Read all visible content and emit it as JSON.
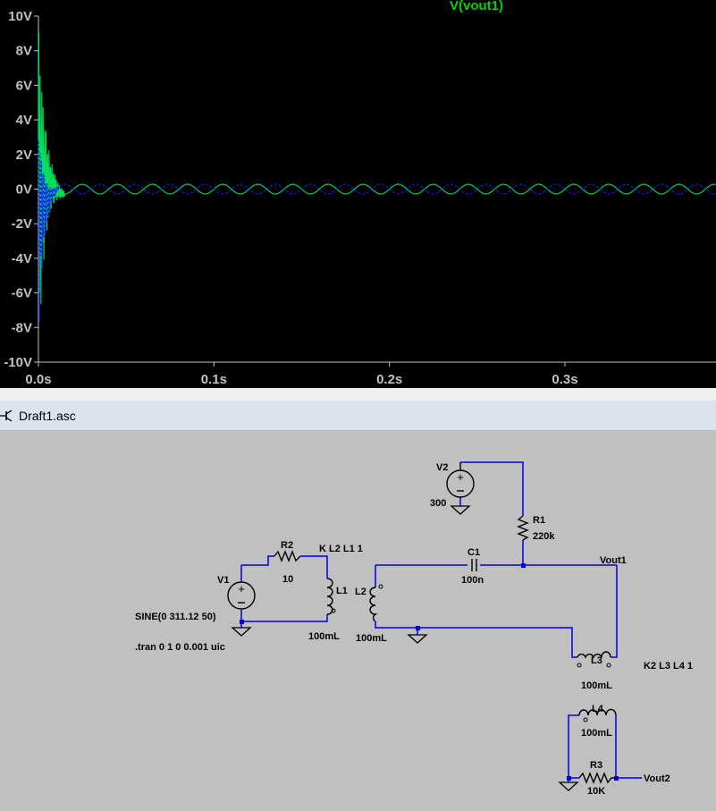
{
  "plot": {
    "trace_name": "V(vout1)",
    "y_ticks": [
      "10V",
      "8V",
      "6V",
      "4V",
      "2V",
      "0V",
      "-2V",
      "-4V",
      "-6V",
      "-8V",
      "-10V"
    ],
    "x_ticks": [
      "0.0s",
      "0.1s",
      "0.2s",
      "0.3s"
    ],
    "colors": {
      "background": "#000000",
      "axis": "#c0c0c0",
      "trace_green": "#00e05a",
      "trace_blue": "#1a1aff"
    }
  },
  "chart_data": {
    "type": "line",
    "title": "V(vout1)",
    "xlabel": "",
    "ylabel": "",
    "xlim": [
      0,
      0.39
    ],
    "ylim": [
      -10,
      10
    ],
    "grid": false,
    "series": [
      {
        "name": "V(vout1)",
        "color": "#00e05a",
        "frequency_hz": 50,
        "steady_amplitude_v": 0.28,
        "initial_spike_v": [
          10,
          -10
        ],
        "settle_time_s": 0.015
      },
      {
        "color": "#1a1aff",
        "frequency_hz": 50,
        "steady_amplitude_v": 0.28,
        "initial_spike_v": [
          3.3,
          -9
        ],
        "settle_time_s": 0.012
      }
    ]
  },
  "tab": {
    "label": "Draft1.asc",
    "icon": "schematic-icon"
  },
  "schematic": {
    "v1": {
      "name": "V1",
      "value": "SINE(0 311.12 50)"
    },
    "v2": {
      "name": "V2",
      "value": "300"
    },
    "r1": {
      "name": "R1",
      "value": "220k"
    },
    "r2": {
      "name": "R2",
      "value": "10"
    },
    "r3": {
      "name": "R3",
      "value": "10K"
    },
    "c1": {
      "name": "C1",
      "value": "100n"
    },
    "l1": {
      "name": "L1",
      "value": "100mL"
    },
    "l2": {
      "name": "L2",
      "value": "100mL"
    },
    "l3": {
      "name": "L3",
      "value": "100mL"
    },
    "l4": {
      "name": "L4",
      "value": "100mL"
    },
    "k1": "K L2 L1 1",
    "k2": "K2 L3 L4 1",
    "tran": ".tran 0 1 0 0.001 uic",
    "net_vout1": "Vout1",
    "net_vout2": "Vout2"
  }
}
